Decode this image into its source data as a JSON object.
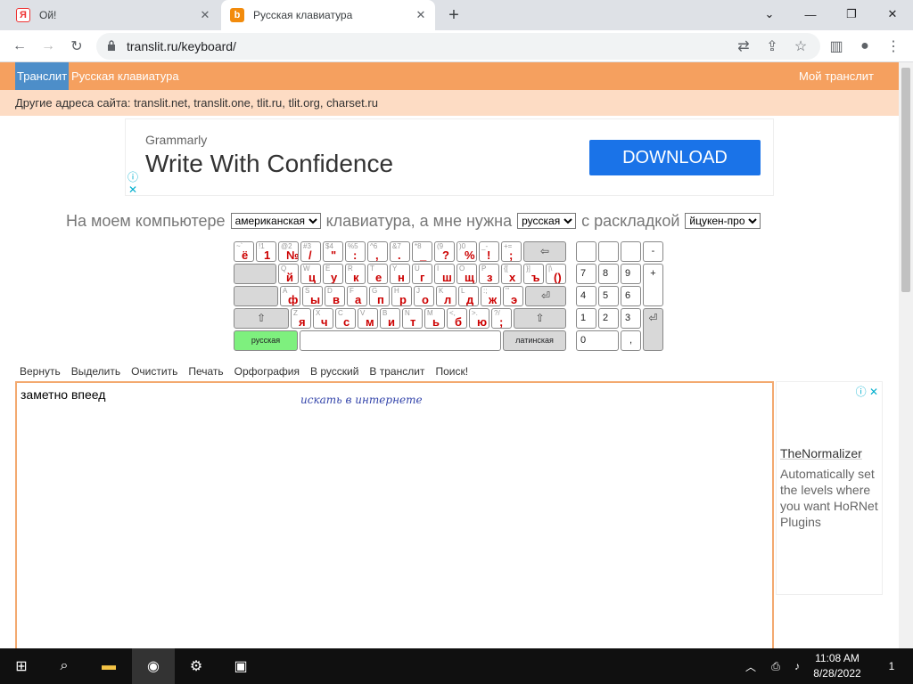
{
  "browser": {
    "tabs": [
      {
        "title": "Ой!",
        "icon": "yandex-icon"
      },
      {
        "title": "Русская клавиатура",
        "icon": "translit-icon"
      }
    ],
    "url": "translit.ru/keyboard/"
  },
  "site": {
    "nav": {
      "site_link": "Транслит",
      "page_link": "Русская клавиатура",
      "my_link": "Мой транслит"
    },
    "addresses": "Другие адреса сайта: translit.net, translit.one, tlit.ru, tlit.org, charset.ru"
  },
  "ad": {
    "brand": "Grammarly",
    "headline": "Write With Confidence",
    "button": "DOWNLOAD"
  },
  "layout_prompt": {
    "part1": "На моем компьютере",
    "select1": "американская",
    "part2": "клавиатура, а мне нужна",
    "select2": "русская",
    "part3": "с раскладкой",
    "select3": "йцукен-про"
  },
  "keyboard": {
    "row0": [
      [
        "~`",
        "ё"
      ],
      [
        "!1",
        "1"
      ],
      [
        "@2",
        "№"
      ],
      [
        "#3",
        "/"
      ],
      [
        "$4",
        "\""
      ],
      [
        "%5",
        ":"
      ],
      [
        "^6",
        ","
      ],
      [
        "&7",
        "."
      ],
      [
        "*8",
        "_"
      ],
      [
        "(9",
        "?"
      ],
      [
        ")0",
        "%"
      ],
      [
        "_-",
        "!"
      ],
      [
        "+=",
        ";"
      ]
    ],
    "row1": [
      [
        "Q",
        "й"
      ],
      [
        "W",
        "ц"
      ],
      [
        "E",
        "у"
      ],
      [
        "R",
        "к"
      ],
      [
        "T",
        "е"
      ],
      [
        "Y",
        "н"
      ],
      [
        "U",
        "г"
      ],
      [
        "I",
        "ш"
      ],
      [
        "O",
        "щ"
      ],
      [
        "P",
        "з"
      ],
      [
        "{[",
        "х"
      ],
      [
        "}]",
        "ъ"
      ],
      [
        "|\\",
        "()"
      ]
    ],
    "row2": [
      [
        "A",
        "ф"
      ],
      [
        "S",
        "ы"
      ],
      [
        "D",
        "в"
      ],
      [
        "F",
        "а"
      ],
      [
        "G",
        "п"
      ],
      [
        "H",
        "р"
      ],
      [
        "J",
        "о"
      ],
      [
        "K",
        "л"
      ],
      [
        "L",
        "д"
      ],
      [
        ":;",
        "ж"
      ],
      [
        "\"'",
        "э"
      ]
    ],
    "row3": [
      [
        "Z",
        "я"
      ],
      [
        "X",
        "ч"
      ],
      [
        "C",
        "с"
      ],
      [
        "V",
        "м"
      ],
      [
        "B",
        "и"
      ],
      [
        "N",
        "т"
      ],
      [
        "M",
        "ь"
      ],
      [
        "<,",
        "б"
      ],
      [
        ">.",
        "ю"
      ],
      [
        "?/",
        ";"
      ]
    ],
    "backspace": "⇦",
    "enter": "⏎",
    "shift": "⇧",
    "lang_ru": "русская",
    "lang_lat": "латинская",
    "numpad": {
      "minus": "-",
      "plus": "+",
      "enter": "⏎",
      "comma": ",",
      "digits": [
        "7",
        "8",
        "9",
        "4",
        "5",
        "6",
        "1",
        "2",
        "3",
        "0"
      ]
    }
  },
  "menu": [
    "Вернуть",
    "Выделить",
    "Очистить",
    "Печать",
    "Орфография",
    "В русский",
    "В транслит",
    "Поиск!"
  ],
  "editor": {
    "value": "заметно впеед",
    "hint": "искать в интернете"
  },
  "side_ad": {
    "title": "TheNormalizer",
    "desc": "Automatically set the levels where you want HoRNet Plugins"
  },
  "taskbar": {
    "time": "11:08 AM",
    "date": "8/28/2022",
    "notification_count": "1"
  }
}
